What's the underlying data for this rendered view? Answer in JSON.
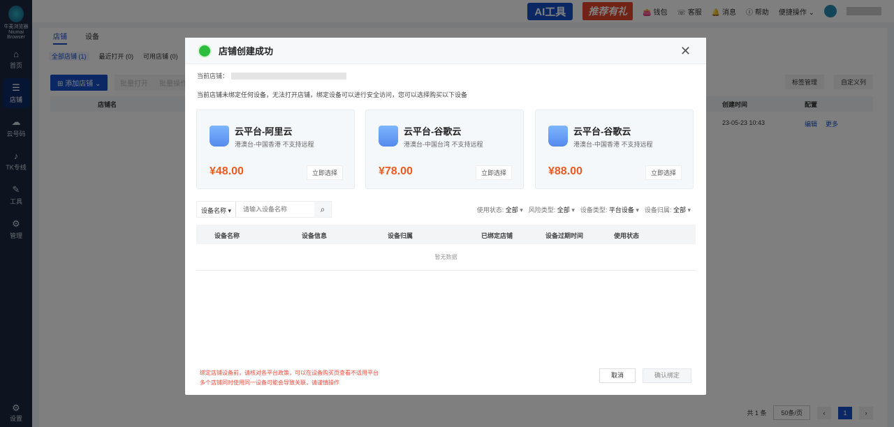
{
  "sidebar": {
    "brand": "牛麦浏览器",
    "brand_en": "Niumai Browser",
    "items": [
      {
        "label": "首页",
        "icon": "home-icon"
      },
      {
        "label": "店铺",
        "icon": "store-icon"
      },
      {
        "label": "云号码",
        "icon": "cloud-icon"
      },
      {
        "label": "TK专线",
        "icon": "tiktok-icon"
      },
      {
        "label": "工具",
        "icon": "wrench-icon"
      },
      {
        "label": "管理",
        "icon": "manage-icon"
      }
    ],
    "settings": "设置"
  },
  "header": {
    "ai": "AI工具",
    "gift": "推荐有礼",
    "wallet": "钱包",
    "service": "客服",
    "message": "消息",
    "help": "帮助",
    "quick": "便捷操作"
  },
  "page": {
    "tabs": [
      "店铺",
      "设备"
    ],
    "subtabs": [
      "全部店铺 (1)",
      "最近打开 (0)",
      "可用店铺 (0)"
    ],
    "add": "添加店铺",
    "batch_open": "批量打开",
    "batch_op": "批量操作",
    "tag_mgmt": "标签管理",
    "custom_cols": "自定义列",
    "col_name": "店铺名",
    "col_created": "创建时间",
    "col_config": "配置",
    "row_created": "23-05-23 10:43",
    "row_edit": "编辑",
    "row_more": "更多",
    "total": "共 1 条",
    "page_size": "50条/页",
    "page": "1"
  },
  "modal": {
    "title": "店铺创建成功",
    "current_label": "当前店铺：",
    "tip": "当前店铺未绑定任何设备，无法打开店铺，绑定设备可以进行安全访问，您可以选择购买以下设备",
    "cards": [
      {
        "title": "云平台-阿里云",
        "desc": "港澳台-中国香港 不支持远程",
        "price": "¥48.00",
        "button": "立即选择"
      },
      {
        "title": "云平台-谷歌云",
        "desc": "港澳台-中国台湾 不支持远程",
        "price": "¥78.00",
        "button": "立即选择"
      },
      {
        "title": "云平台-谷歌云",
        "desc": "港澳台-中国香港 不支持远程",
        "price": "¥88.00",
        "button": "立即选择"
      }
    ],
    "search_field": "设备名称",
    "search_placeholder": "请输入设备名称",
    "filters": [
      {
        "label": "使用状态:",
        "value": "全部"
      },
      {
        "label": "风险类型:",
        "value": "全部"
      },
      {
        "label": "设备类型:",
        "value": "平台设备"
      },
      {
        "label": "设备归属:",
        "value": "全部"
      }
    ],
    "columns": [
      "设备名称",
      "设备信息",
      "设备归属",
      "已绑定店铺",
      "设备过期时间",
      "使用状态"
    ],
    "empty": "暂无数据",
    "warning": [
      "绑定店铺设备前，请核对各平台政策，可以在设备购买页查看不适用平台",
      "多个店铺同时使用同一设备可能会导致关联，请谨慎操作"
    ],
    "cancel": "取消",
    "confirm": "确认绑定"
  }
}
